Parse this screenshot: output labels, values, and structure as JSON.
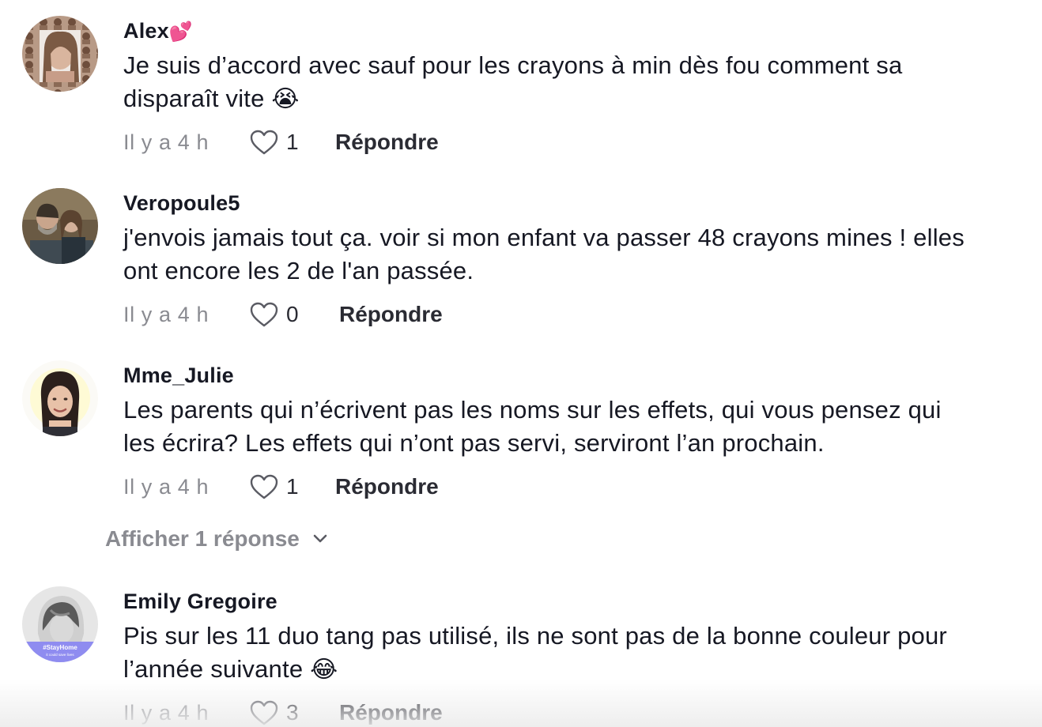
{
  "comments": [
    {
      "username": "Alex",
      "username_emoji": "💕",
      "line1": "Je suis d’accord avec sauf pour les crayons à min dès fou comment sa",
      "line2": "disparaît vite",
      "line2_emoji": "😭",
      "time": "Il y a 4 h",
      "likes": "1",
      "reply_label": "Répondre"
    },
    {
      "username": "Veropoule5",
      "line1": "j'envois jamais tout ça. voir si mon enfant va passer 48 crayons mines ! elles",
      "line2": "ont encore les 2 de l'an passée.",
      "time": "Il y a 4 h",
      "likes": "0",
      "reply_label": "Répondre"
    },
    {
      "username": "Mme_Julie",
      "line1": "Les parents qui n’écrivent pas les noms sur les effets, qui vous pensez qui",
      "line2": "les écrira? Les effets qui n’ont pas servi, serviront l’an prochain.",
      "time": "Il y a 4 h",
      "likes": "1",
      "reply_label": "Répondre",
      "view_replies": "Afficher 1 réponse"
    },
    {
      "username": "Emily Gregoire",
      "line1": "Pis sur les 11 duo tang pas utilisé, ils ne sont pas de la bonne couleur pour",
      "line2": "l’année suivante",
      "line2_emoji": "😂",
      "time": "Il y a 4 h",
      "likes": "3",
      "reply_label": "Répondre",
      "avatar_badge": "#StayHome",
      "avatar_badge_sub": "it could save lives"
    }
  ],
  "icons": {
    "like": "heart-outline-icon",
    "expand": "chevron-down-icon"
  },
  "colors": {
    "text": "#161823",
    "muted": "#8a8b91",
    "badge": "#8f8cf0"
  }
}
